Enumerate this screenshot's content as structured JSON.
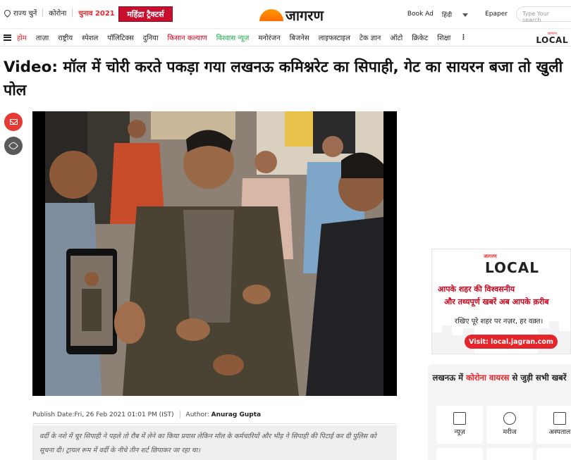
{
  "topbar": {
    "state_select": "राज्य चुनें",
    "corona": "कोरोना",
    "election": "चुनाव 2021",
    "sponsor": "महिंद्रा ट्रैक्टर्स",
    "logo": "जागरण",
    "book_ad": "Book Ad",
    "language": "हिंदी",
    "epaper": "Epaper",
    "search_placeholder": "Type Your search"
  },
  "nav": {
    "items": [
      "होम",
      "ताज़ा",
      "राष्ट्रीय",
      "स्पेशल",
      "पॉलिटिक्स",
      "दुनिया",
      "किसान कल्याण",
      "विश्वास न्यूज़",
      "मनोरंजन",
      "बिजनेस",
      "लाइफस्टाइल",
      "टेक ज्ञान",
      "ऑटो",
      "क्रिकेट",
      "शिक्षा"
    ],
    "more": "⋮",
    "local_small": "जागरण",
    "local_big": "LOCAL"
  },
  "article": {
    "headline": "Video: मॉल में चोरी करते पकड़ा गया लखनऊ कमिश्नरेट का सिपाही, गेट का सायरन बजा तो खुली पोल",
    "publish_label": "Publish Date:",
    "publish_date": "Fri, 26 Feb 2021 01:01 PM (IST)",
    "author_label": "Author:",
    "author": "Anurag Gupta",
    "summary": "वर्दी के नशे में चूर सिपाही ने पहले तो रौब में लेने का किया प्रयास लेकिन मॉल के कर्मचारियों और भीड़ ने सिपाही की पिटाई कर दी पुलिस को सूचना दी। ट्रायल रूम में वर्दी के नीचे तीन शर्ट छिपाकर जा रहा था।"
  },
  "ad": {
    "brand": "जागरण",
    "local": "LOCAL",
    "line1": "आपके शहर की विश्वसनीय",
    "line2": "और तथ्यपूर्ण खबरें अब आपके क़रीब",
    "line3": "रखिए पूरे शहर पर नज़र, हर वक़्त।",
    "cta": "Visit: local.jagran.com"
  },
  "corona_box": {
    "title_pre": "लखनऊ में",
    "title_red": "कोरोना वायरस",
    "title_post": "से जुड़ी सभी खबरें",
    "tiles": [
      "न्यूज़",
      "मरीज",
      "अस्पताल"
    ]
  },
  "colors": {
    "brand_red": "#e4262c",
    "green": "#19a84a",
    "sponsor_red": "#c8102e"
  },
  "icons": [
    "location-pin-icon",
    "menu-icon",
    "mail-icon",
    "tag-icon",
    "news-icon",
    "patient-icon",
    "hospital-icon"
  ]
}
